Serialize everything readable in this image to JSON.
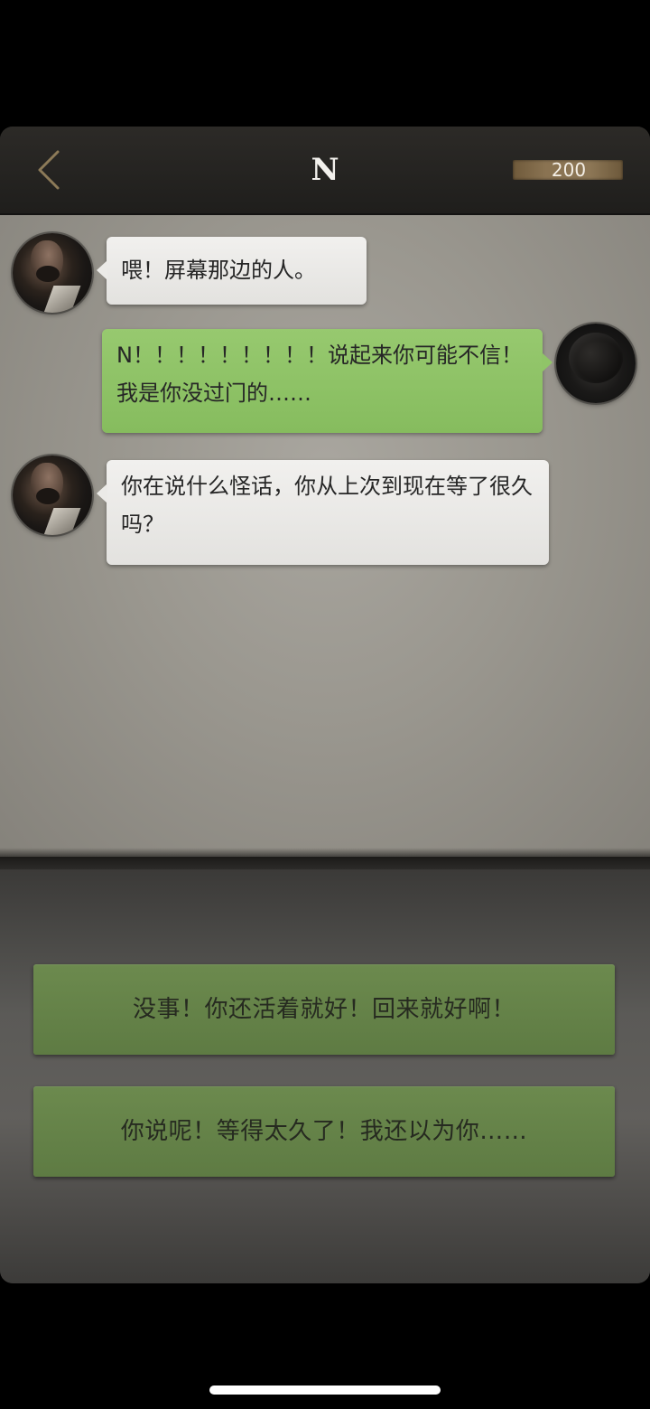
{
  "header": {
    "title": "N",
    "coins": "200"
  },
  "messages": [
    {
      "side": "left",
      "text": "喂！屏幕那边的人。"
    },
    {
      "side": "right",
      "text": "N！！！！！！！！！说起来你可能不信！我是你没过门的……"
    },
    {
      "side": "left",
      "text": "你在说什么怪话，你从上次到现在等了很久吗？"
    }
  ],
  "options": [
    {
      "label": "没事！你还活着就好！回来就好啊！"
    },
    {
      "label": "你说呢！等得太久了！我还以为你……"
    }
  ],
  "colors": {
    "incoming_bubble": "#ebeae7",
    "outgoing_bubble": "#90c468",
    "option_button": "#65834a",
    "coin_box": "#8a7352"
  },
  "icons": {
    "back": "chevron-left-icon"
  }
}
